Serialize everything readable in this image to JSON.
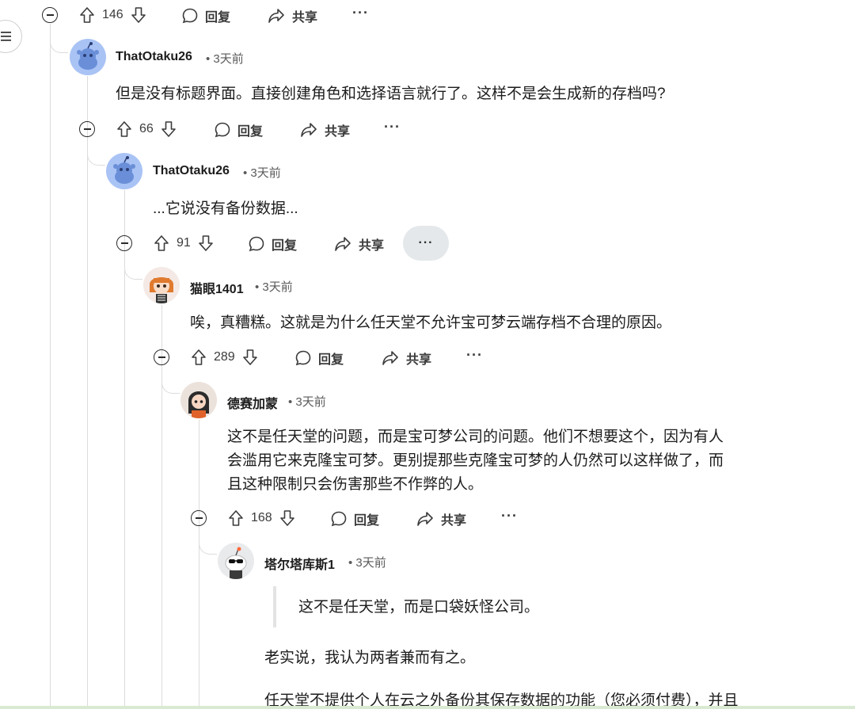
{
  "nav": {
    "menu_icon": "hamburger-icon"
  },
  "actions": {
    "reply": "回复",
    "share": "共享",
    "more": "···"
  },
  "top_row": {
    "votes": "146"
  },
  "comments": [
    {
      "username": "ThatOtaku26",
      "time": "• 3天前",
      "text": "但是没有标题界面。直接创建角色和选择语言就行了。这样不是会生成新的存档吗?",
      "votes": "66"
    },
    {
      "username": "ThatOtaku26",
      "time": "• 3天前",
      "text": "...它说没有备份数据...",
      "votes": "91"
    },
    {
      "username": "猫眼1401",
      "time": "• 3天前",
      "text": "唉，真糟糕。这就是为什么任天堂不允许宝可梦云端存档不合理的原因。",
      "votes": "289"
    },
    {
      "username": "德赛加蒙",
      "time": "• 3天前",
      "lines": [
        "这不是任天堂的问题，而是宝可梦公司的问题。他们不想要这个，因为有人",
        "会滥用它来克隆宝可梦。更别提那些克隆宝可梦的人仍然可以这样做了，而",
        "且这种限制只会伤害那些不作弊的人。"
      ],
      "votes": "168"
    },
    {
      "username": "塔尔塔库斯1",
      "time": "• 3天前",
      "quote": "这不是任天堂，而是口袋妖怪公司。",
      "para1": "老实说，我认为两者兼而有之。",
      "para2": "任天堂不提供个人在云之外备份其保存数据的功能（您必须付费），并且"
    }
  ]
}
